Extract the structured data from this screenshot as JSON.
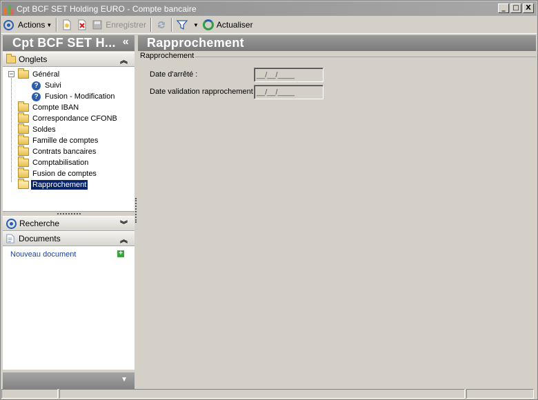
{
  "window": {
    "title": "Cpt BCF SET Holding EURO -  Compte bancaire",
    "buttons": {
      "minimize": "_",
      "maximize": "□",
      "close": "X"
    }
  },
  "toolbar": {
    "actions_label": "Actions",
    "save_label": "Enregistrer",
    "refresh_label": "Actualiser",
    "save_enabled": false
  },
  "left_panel": {
    "header": "Cpt BCF SET H...",
    "collapse_glyph": "«",
    "onglets": {
      "title": "Onglets",
      "chevron": "⌃",
      "tree": [
        {
          "label": "Général",
          "level": 0,
          "type": "folder",
          "expanded": true
        },
        {
          "label": "Suivi",
          "level": 1,
          "type": "help"
        },
        {
          "label": "Fusion - Modification",
          "level": 1,
          "type": "help"
        },
        {
          "label": "Compte IBAN",
          "level": 0,
          "type": "folder"
        },
        {
          "label": "Correspondance CFONB",
          "level": 0,
          "type": "folder"
        },
        {
          "label": "Soldes",
          "level": 0,
          "type": "folder"
        },
        {
          "label": "Famille de comptes",
          "level": 0,
          "type": "folder"
        },
        {
          "label": "Contrats bancaires",
          "level": 0,
          "type": "folder"
        },
        {
          "label": "Comptabilisation",
          "level": 0,
          "type": "folder"
        },
        {
          "label": "Fusion de comptes",
          "level": 0,
          "type": "folder"
        },
        {
          "label": "Rapprochement",
          "level": 0,
          "type": "folder-open",
          "selected": true
        }
      ]
    },
    "recherche": {
      "title": "Recherche",
      "chevron": "⌄"
    },
    "documents": {
      "title": "Documents",
      "chevron": "⌃",
      "new_document": "Nouveau document",
      "add_glyph": "+"
    }
  },
  "main": {
    "title": "Rapprochement",
    "group_title": "Rapprochement",
    "fields": [
      {
        "label": "Date d'arrêté :",
        "value": "__/__/____"
      },
      {
        "label": "Date validation rapprochement :",
        "value": "__/__/____"
      }
    ]
  },
  "colors": {
    "header_gradient": "#8a8a8a",
    "selection": "#0a246a",
    "link": "#1a3fa8",
    "window_bg": "#d4d0c8"
  }
}
